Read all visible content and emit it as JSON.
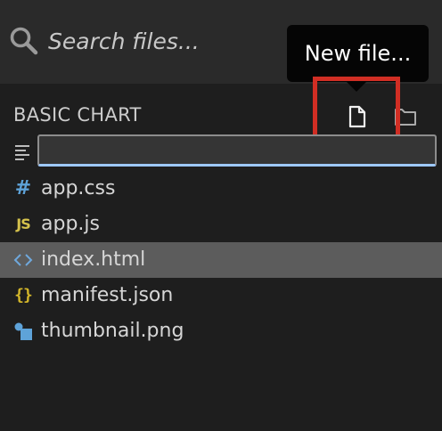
{
  "search": {
    "placeholder": "Search files..."
  },
  "tooltip": {
    "text": "New file..."
  },
  "explorer": {
    "title": "BASIC CHART",
    "new_file_input_value": ""
  },
  "files": [
    {
      "name": "app.css",
      "icon": "css-icon",
      "selected": false
    },
    {
      "name": "app.js",
      "icon": "js-icon",
      "selected": false
    },
    {
      "name": "index.html",
      "icon": "html-icon",
      "selected": true
    },
    {
      "name": "manifest.json",
      "icon": "json-icon",
      "selected": false
    },
    {
      "name": "thumbnail.png",
      "icon": "image-icon",
      "selected": false
    }
  ],
  "colors": {
    "background": "#1e1e1e",
    "search_bar": "#2a2a2a",
    "selected_row": "#5c5c5c",
    "highlight_box": "#d12e24",
    "input_focus_border": "#9ec9ff"
  }
}
